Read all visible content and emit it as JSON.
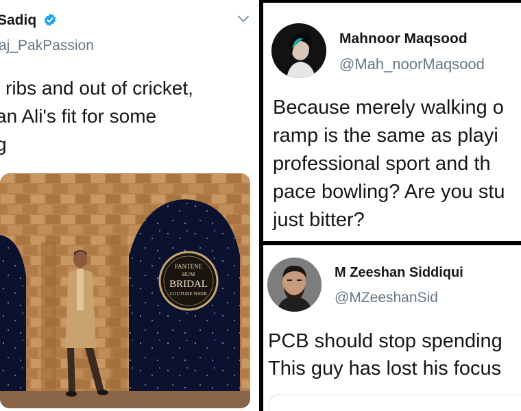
{
  "tweet1": {
    "author_name": "Sadiq",
    "handle": "aj_PakPassion",
    "text": "l ribs and out of cricket,\nan Ali's fit for some\ng",
    "banner": {
      "line1": "PANTENE",
      "line2": "HUM",
      "line3": "BRIDAL",
      "line4": "COUTURE WEEK"
    },
    "icons": [
      "verified-icon",
      "chevron-down-icon"
    ]
  },
  "tweet2": {
    "author_name": "Mahnoor Maqsood",
    "handle": "@Mah_noorMaqsood",
    "text": "Because merely walking o\nramp is the same as playi\nprofessional sport and th\npace bowling? Are you stu\njust bitter?"
  },
  "tweet3": {
    "author_name": "M Zeeshan Siddiqui",
    "handle": "@MZeeshanSid",
    "text": "PCB should stop spending\nThis guy has lost his focus"
  },
  "colors": {
    "text": "#14171a",
    "muted": "#657786",
    "verified": "#1da1f2",
    "divider": "#000000"
  }
}
